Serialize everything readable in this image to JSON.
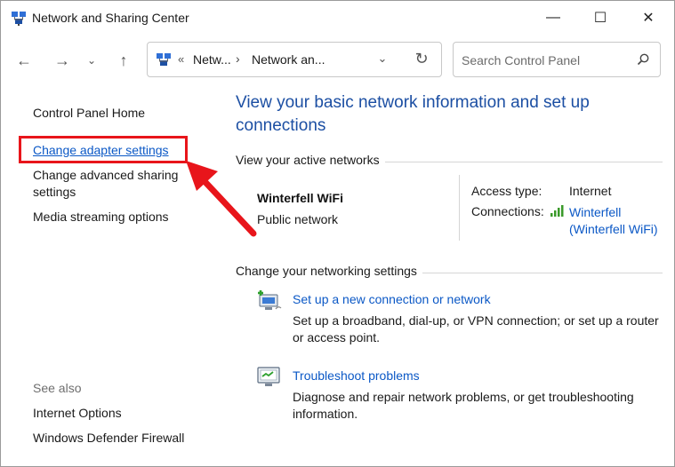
{
  "window": {
    "title": "Network and Sharing Center",
    "minimize_glyph": "—",
    "maximize_glyph": "☐",
    "close_glyph": "✕"
  },
  "nav": {
    "back_glyph": "←",
    "forward_glyph": "→",
    "recent_glyph": "⌄",
    "up_glyph": "↑"
  },
  "address": {
    "overflow_glyph": "«",
    "segment1": "Netw...",
    "separator": "›",
    "segment2": "Network an...",
    "dropdown_glyph": "⌄",
    "refresh_glyph": "↻"
  },
  "search": {
    "placeholder": "Search Control Panel",
    "value": ""
  },
  "sidebar": {
    "home": "Control Panel Home",
    "adapter": "Change adapter settings",
    "advanced": "Change advanced sharing settings",
    "media": "Media streaming options",
    "see_also": "See also",
    "internet_options": "Internet Options",
    "firewall": "Windows Defender Firewall"
  },
  "main": {
    "title": "View your basic network information and set up connections",
    "active_heading": "View your active networks",
    "network": {
      "name": "Winterfell WiFi",
      "type": "Public network",
      "access_label": "Access type:",
      "access_value": "Internet",
      "connections_label": "Connections:",
      "connections_value": "Winterfell (Winterfell WiFi)"
    },
    "change_heading": "Change your networking settings",
    "tasks": [
      {
        "link": "Set up a new connection or network",
        "desc": "Set up a broadband, dial-up, or VPN connection; or set up a router or access point."
      },
      {
        "link": "Troubleshoot problems",
        "desc": "Diagnose and repair network problems, or get troubleshooting information."
      }
    ]
  },
  "colors": {
    "link": "#0b58c6",
    "title": "#1c4fa3",
    "annotation": "#e8151b"
  },
  "icons": {
    "app": "network-icon",
    "search": "search-icon",
    "signal": "wifi-signal-icon",
    "new_connection": "new-connection-icon",
    "troubleshoot": "troubleshoot-icon"
  }
}
